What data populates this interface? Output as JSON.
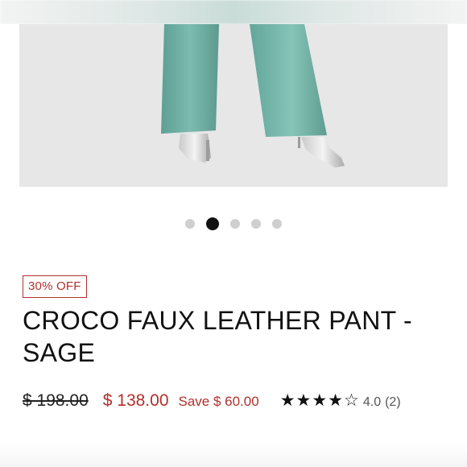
{
  "product": {
    "badge": "30% OFF",
    "title": "CROCO FAUX LEATHER PANT - SAGE",
    "original_price": "$ 198.00",
    "sale_price": "$ 138.00",
    "savings": "Save $ 60.00",
    "rating": {
      "stars_display": "★★★★☆",
      "value": "4.0",
      "count": "(2)",
      "stars_filled": 4,
      "stars_total": 5
    }
  },
  "gallery": {
    "image_subject": "model wearing sage croco faux leather pants with silver pumps",
    "dots_total": 5,
    "active_index": 1
  },
  "colors": {
    "accent_red": "#b0302c",
    "pant_sage": "#6fb3a6",
    "text_dark": "#111111"
  }
}
